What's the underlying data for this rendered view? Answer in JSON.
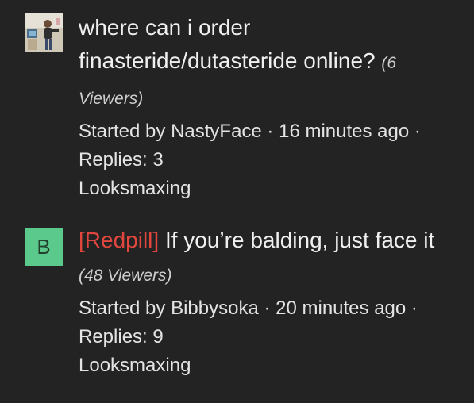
{
  "threads": [
    {
      "avatar": {
        "type": "photo",
        "icon": "user-photo-icon"
      },
      "title": "where can i order finasteride/dutasteride online?",
      "viewers": "(6 Viewers)",
      "started_by_prefix": "Started by ",
      "author": "NastyFace",
      "separator": " · ",
      "time": "16 minutes ago",
      "replies": "Replies: 3",
      "forum": "Looksmaxing"
    },
    {
      "avatar": {
        "type": "letter",
        "letter": "B",
        "color": "#5cc98c"
      },
      "prefix": "[Redpill]",
      "title": "If you’re balding, just face it",
      "viewers": "(48 Viewers)",
      "started_by_prefix": "Started by ",
      "author": "Bibbysoka",
      "separator": " · ",
      "time": "20 minutes ago",
      "replies": "Replies: 9",
      "forum": "Looksmaxing"
    }
  ]
}
